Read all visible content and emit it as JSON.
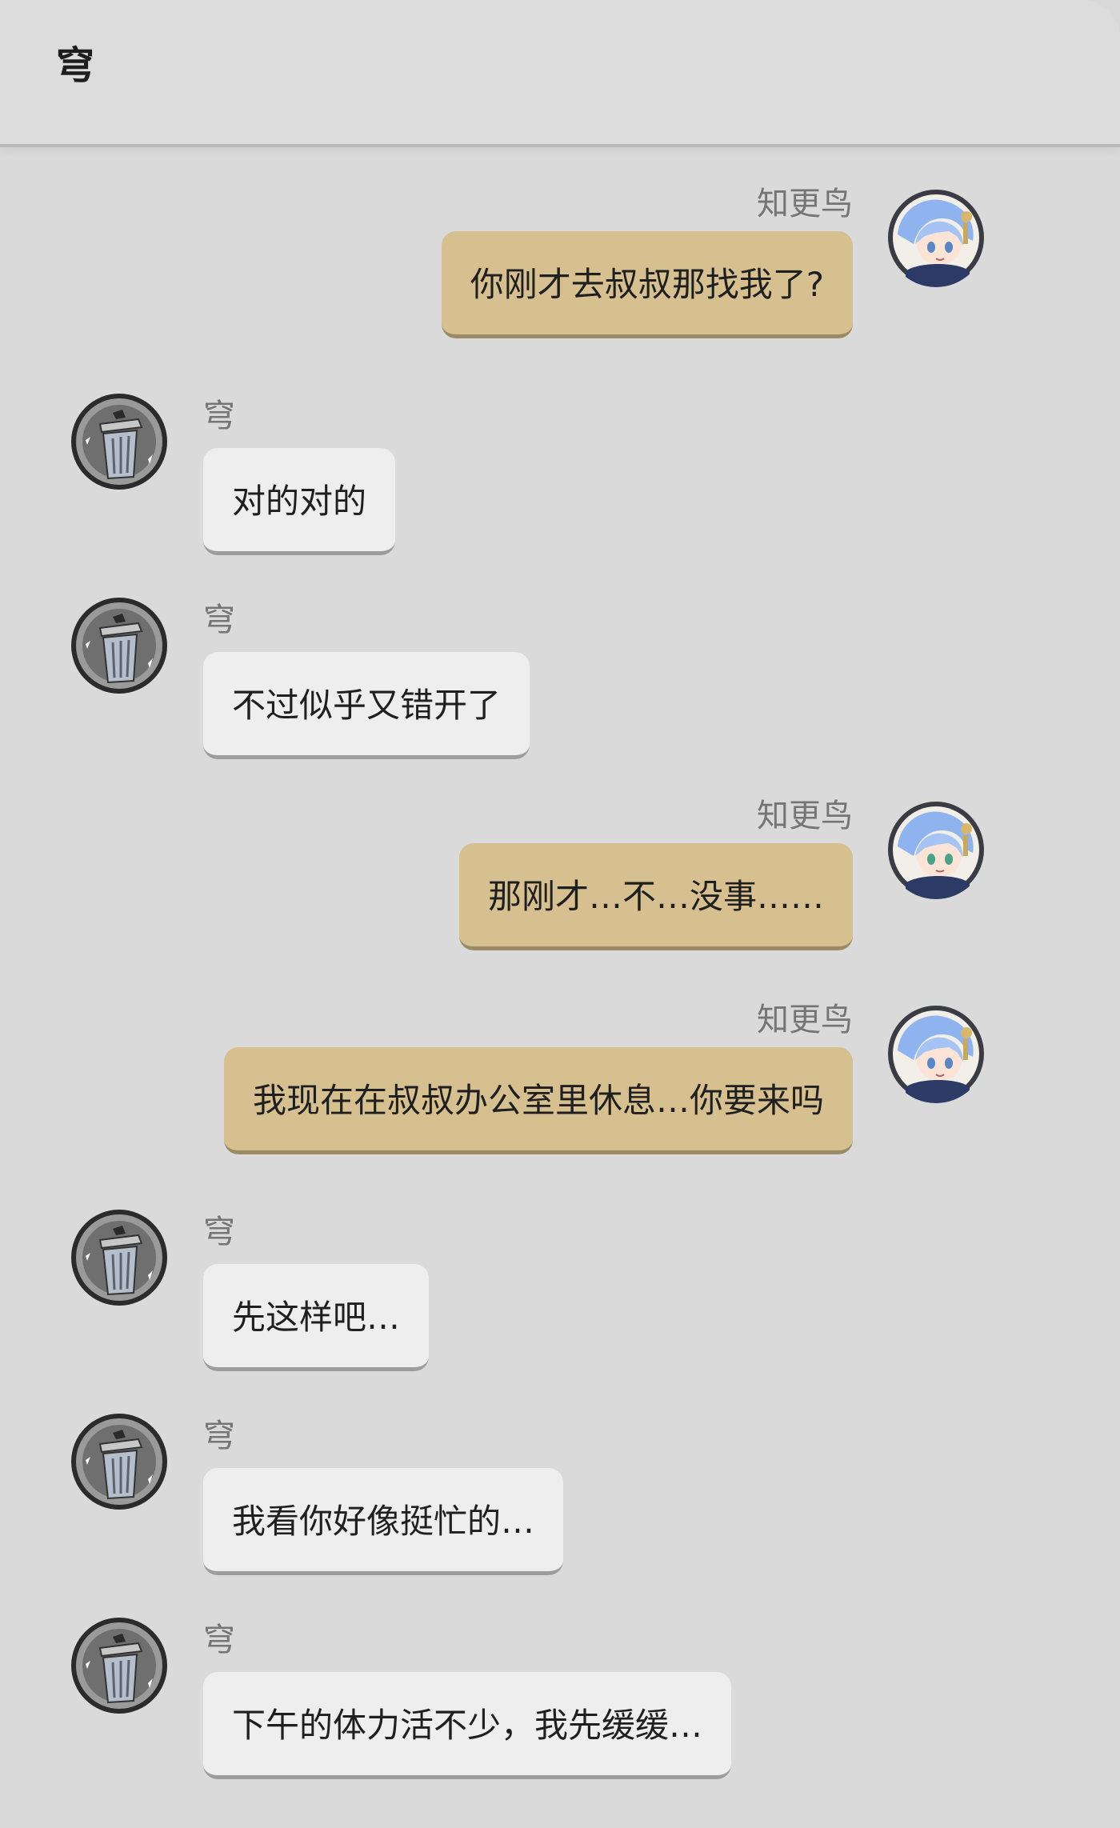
{
  "header": {
    "title": "穹"
  },
  "messages": [
    {
      "side": "out",
      "sender": "知更鸟",
      "text": "你刚才去叔叔那找我了?",
      "avatar": "robin-avatar"
    },
    {
      "side": "in",
      "sender": "穹",
      "text": "对的对的",
      "avatar": "trashcan-avatar"
    },
    {
      "side": "in",
      "sender": "穹",
      "text": "不过似乎又错开了",
      "avatar": "trashcan-avatar"
    },
    {
      "side": "out",
      "sender": "知更鸟",
      "text": "那刚才…不…没事……",
      "avatar": "robin-avatar"
    },
    {
      "side": "out",
      "sender": "知更鸟",
      "text": "我现在在叔叔办公室里休息…你要来吗",
      "avatar": "robin-avatar"
    },
    {
      "side": "in",
      "sender": "穹",
      "text": "先这样吧…",
      "avatar": "trashcan-avatar"
    },
    {
      "side": "in",
      "sender": "穹",
      "text": "我看你好像挺忙的…",
      "avatar": "trashcan-avatar"
    },
    {
      "side": "in",
      "sender": "穹",
      "text": "下午的体力活不少，我先缓缓…",
      "avatar": "trashcan-avatar"
    }
  ],
  "colors": {
    "background": "#dadada",
    "outgoing_bubble": "#d6c08f",
    "incoming_bubble": "#eeeeee",
    "name_text": "#757575"
  }
}
